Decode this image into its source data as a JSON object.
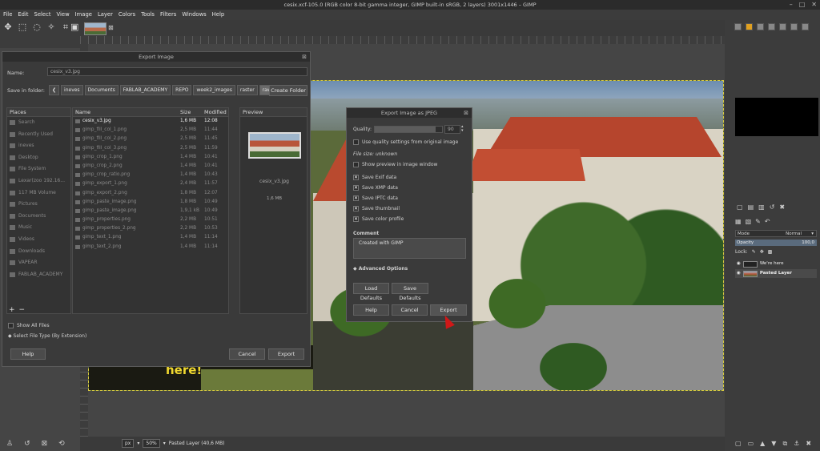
{
  "window": {
    "title": "cesix.xcf-105.0 (RGB color 8-bit gamma integer, GIMP built-in sRGB, 2 layers) 3001x1446 – GIMP",
    "min": "–",
    "max": "□",
    "close": "✕"
  },
  "menu": [
    "File",
    "Edit",
    "Select",
    "View",
    "Image",
    "Layer",
    "Colors",
    "Tools",
    "Filters",
    "Windows",
    "Help"
  ],
  "canvas": {
    "overlay_text": "here!"
  },
  "status": {
    "unit": "px",
    "zoom": "50%",
    "layer": "Pasted Layer (40,6 MB)"
  },
  "layers": {
    "mode": "Mode",
    "mode_value": "Normal",
    "opacity_label": "Opacity",
    "opacity_value": "100,0",
    "lock_label": "Lock:",
    "items": [
      {
        "name": "We're here"
      },
      {
        "name": "Pasted Layer"
      }
    ]
  },
  "export_dialog": {
    "title": "Export Image",
    "name_label": "Name:",
    "name_value": "cesix_v3.jpg",
    "save_in_label": "Save in folder:",
    "crumbs": [
      "ineves",
      "Documents",
      "FABLAB_ACADEMY",
      "REPO",
      "week2_images",
      "raster",
      "raw"
    ],
    "create_folder": "Create Folder",
    "places_header": "Places",
    "places": [
      "Search",
      "Recently Used",
      "ineves",
      "Desktop",
      "File System",
      "Lexar(zoo 192.16...",
      "117 MB Volume",
      "Pictures",
      "Documents",
      "Music",
      "Videos",
      "Downloads",
      "VAPEAR",
      "FABLAB_ACADEMY"
    ],
    "cols": {
      "name": "Name",
      "size": "Size",
      "modified": "Modified"
    },
    "files": [
      {
        "name": "cesix_v3.jpg",
        "size": "1,6 MB",
        "modified": "12:08"
      },
      {
        "name": "gimp_fill_col_1.png",
        "size": "2,5 MB",
        "modified": "11:44"
      },
      {
        "name": "gimp_fill_col_2.png",
        "size": "2,5 MB",
        "modified": "11:45"
      },
      {
        "name": "gimp_fill_col_3.png",
        "size": "2,5 MB",
        "modified": "11:59"
      },
      {
        "name": "gimp_crop_1.png",
        "size": "1,4 MB",
        "modified": "10:41"
      },
      {
        "name": "gimp_crop_2.png",
        "size": "1,4 MB",
        "modified": "10:41"
      },
      {
        "name": "gimp_crop_ratio.png",
        "size": "1,4 MB",
        "modified": "10:43"
      },
      {
        "name": "gimp_export_1.png",
        "size": "2,4 MB",
        "modified": "11:57"
      },
      {
        "name": "gimp_export_2.png",
        "size": "1,8 MB",
        "modified": "12:07"
      },
      {
        "name": "gimp_paste_image.png",
        "size": "1,8 MB",
        "modified": "10:49"
      },
      {
        "name": "gimp_paste_image.png",
        "size": "1,9,1 kB",
        "modified": "10:49"
      },
      {
        "name": "gimp_properties.png",
        "size": "2,2 MB",
        "modified": "10:51"
      },
      {
        "name": "gimp_properties_2.png",
        "size": "2,2 MB",
        "modified": "10:53"
      },
      {
        "name": "gimp_text_1.png",
        "size": "1,4 MB",
        "modified": "11:14"
      },
      {
        "name": "gimp_text_2.png",
        "size": "1,4 MB",
        "modified": "11:14"
      }
    ],
    "preview_header": "Preview",
    "preview_name": "cesix_v3.jpg",
    "preview_size": "1,6 MB",
    "show_all": "Show All Files",
    "file_type": "Select File Type (By Extension)",
    "help": "Help",
    "cancel": "Cancel",
    "export": "Export",
    "add": "+",
    "remove": "−"
  },
  "jpeg_dialog": {
    "title": "Export Image as JPEG",
    "quality_label": "Quality:",
    "quality_value": "90",
    "quality_fraction": 0.9,
    "use_quality": "Use quality settings from original image",
    "file_size": "File size: unknown",
    "show_preview": "Show preview in image window",
    "options": [
      "Save Exif data",
      "Save XMP data",
      "Save IPTC data",
      "Save thumbnail",
      "Save color profile"
    ],
    "comment_label": "Comment",
    "comment_value": "Created with GIMP",
    "advanced": "Advanced Options",
    "load_defaults": "Load Defaults",
    "save_defaults": "Save Defaults",
    "help": "Help",
    "cancel": "Cancel",
    "export": "Export"
  }
}
